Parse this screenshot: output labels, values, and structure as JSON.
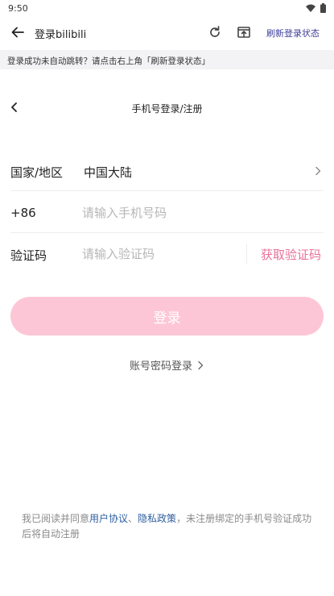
{
  "status_bar": {
    "time": "9:50"
  },
  "app_bar": {
    "title": "登录bilibili",
    "refresh_state_label": "刷新登录状态"
  },
  "notice": {
    "text": "登录成功未自动跳转？请点击右上角「刷新登录状态」"
  },
  "header": {
    "title": "手机号登录/注册"
  },
  "form": {
    "region_label": "国家/地区",
    "region_value": "中国大陆",
    "phone_prefix": "+86",
    "phone_placeholder": "请输入手机号码",
    "code_label": "验证码",
    "code_placeholder": "请输入验证码",
    "get_code_label": "获取验证码"
  },
  "login_button": {
    "label": "登录"
  },
  "password_login": {
    "label": "账号密码登录"
  },
  "agreement": {
    "prefix": "我已阅读并同意",
    "user_agreement": "用户协议",
    "separator": "、",
    "privacy_policy": "隐私政策",
    "suffix": "，未注册绑定的手机号验证成功后将自动注册"
  },
  "colors": {
    "accent_pink": "#e8709a",
    "login_button_bg": "#fdc6d6",
    "link_blue": "#2f5f9e",
    "refresh_state_blue": "#3d3d9a"
  }
}
